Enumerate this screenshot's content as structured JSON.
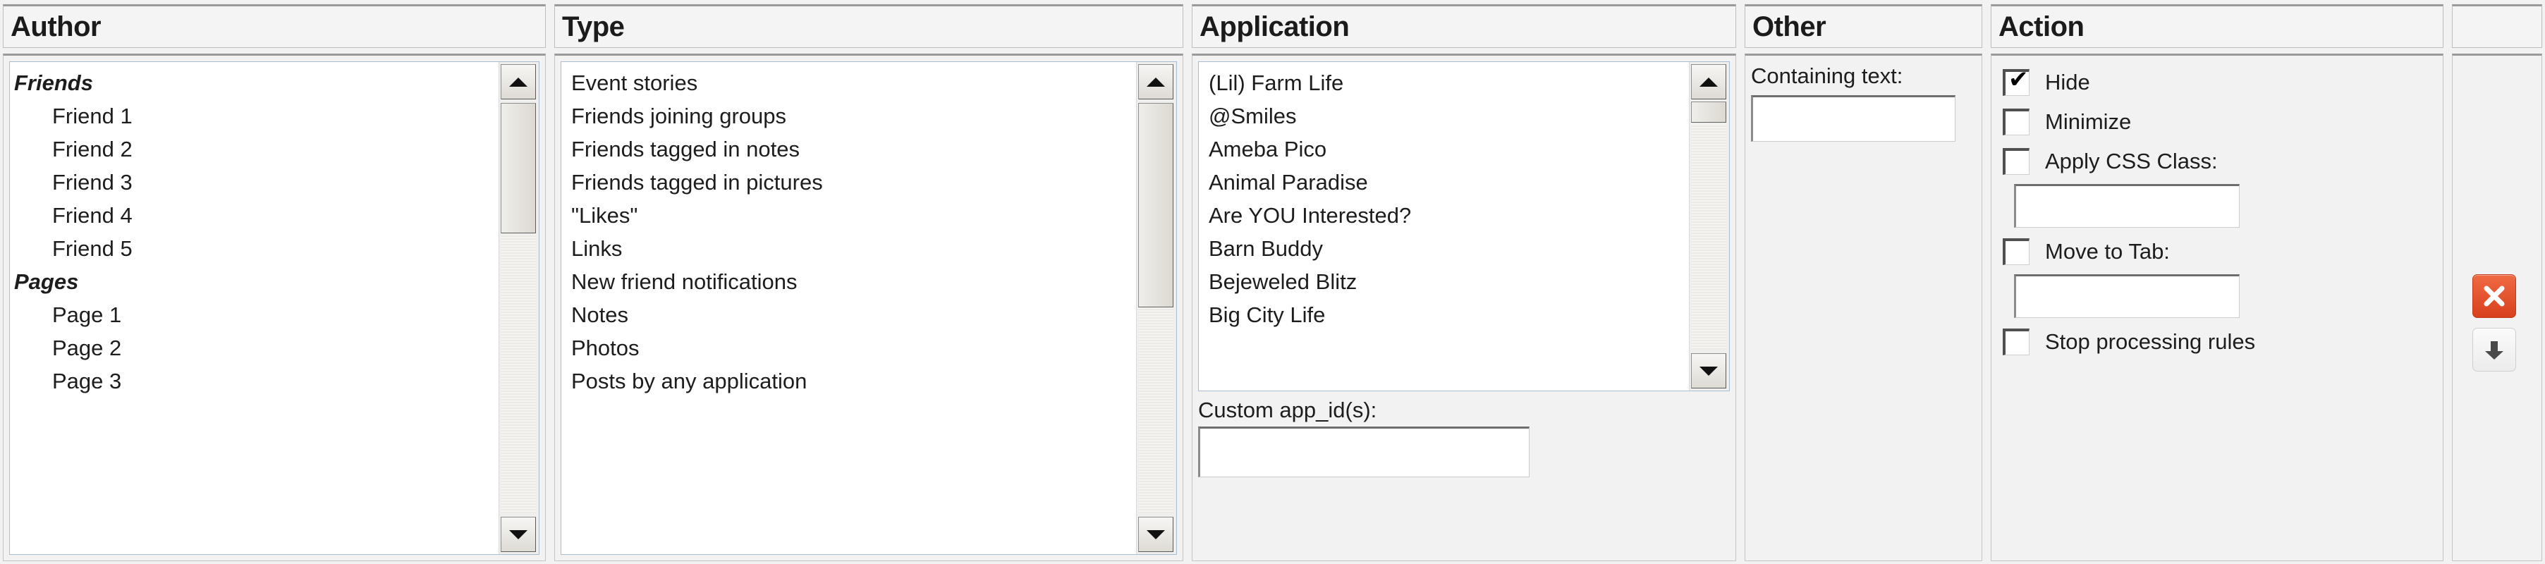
{
  "columns": {
    "author": {
      "header": "Author",
      "items": [
        {
          "label": "Friends",
          "type": "group"
        },
        {
          "label": "Friend 1",
          "type": "child"
        },
        {
          "label": "Friend 2",
          "type": "child"
        },
        {
          "label": "Friend 3",
          "type": "child"
        },
        {
          "label": "Friend 4",
          "type": "child"
        },
        {
          "label": "Friend 5",
          "type": "child"
        },
        {
          "label": "Pages",
          "type": "group"
        },
        {
          "label": "Page 1",
          "type": "child"
        },
        {
          "label": "Page 2",
          "type": "child"
        },
        {
          "label": "Page 3",
          "type": "child"
        }
      ]
    },
    "type": {
      "header": "Type",
      "items": [
        {
          "label": "Event stories",
          "type": "plain"
        },
        {
          "label": "Friends joining groups",
          "type": "plain"
        },
        {
          "label": "Friends tagged in notes",
          "type": "plain"
        },
        {
          "label": "Friends tagged in pictures",
          "type": "plain"
        },
        {
          "label": "\"Likes\"",
          "type": "plain"
        },
        {
          "label": "Links",
          "type": "plain"
        },
        {
          "label": "New friend notifications",
          "type": "plain"
        },
        {
          "label": "Notes",
          "type": "plain"
        },
        {
          "label": "Photos",
          "type": "plain"
        },
        {
          "label": "Posts by any application",
          "type": "plain"
        }
      ]
    },
    "application": {
      "header": "Application",
      "items": [
        {
          "label": "(Lil) Farm Life",
          "type": "plain"
        },
        {
          "label": "@Smiles",
          "type": "plain"
        },
        {
          "label": "Ameba Pico",
          "type": "plain"
        },
        {
          "label": "Animal Paradise",
          "type": "plain"
        },
        {
          "label": "Are YOU Interested?",
          "type": "plain"
        },
        {
          "label": "Barn Buddy",
          "type": "plain"
        },
        {
          "label": "Bejeweled Blitz",
          "type": "plain"
        },
        {
          "label": "Big City Life",
          "type": "plain"
        }
      ],
      "custom_app_label": "Custom app_id(s):",
      "custom_app_value": "",
      "custom_app_placeholder": ""
    },
    "other": {
      "header": "Other",
      "containing_text_label": "Containing text:",
      "containing_text_value": "",
      "containing_text_placeholder": ""
    },
    "action": {
      "header": "Action",
      "hide": {
        "label": "Hide",
        "checked": true
      },
      "minimize": {
        "label": "Minimize",
        "checked": false
      },
      "apply_css": {
        "label": "Apply CSS Class:",
        "checked": false
      },
      "css_class_value": "",
      "move_to_tab": {
        "label": "Move to Tab:",
        "checked": false
      },
      "tab_value": "",
      "stop_processing": {
        "label": "Stop processing rules",
        "checked": false
      }
    },
    "controls": {
      "header": "",
      "delete_icon": "close-x-icon",
      "move_icon": "arrow-down-icon"
    }
  },
  "colors": {
    "delete_button": "#e04a1f",
    "panel_background": "#f2f2f2",
    "list_background": "#ffffff",
    "text": "#1d1d1d"
  }
}
